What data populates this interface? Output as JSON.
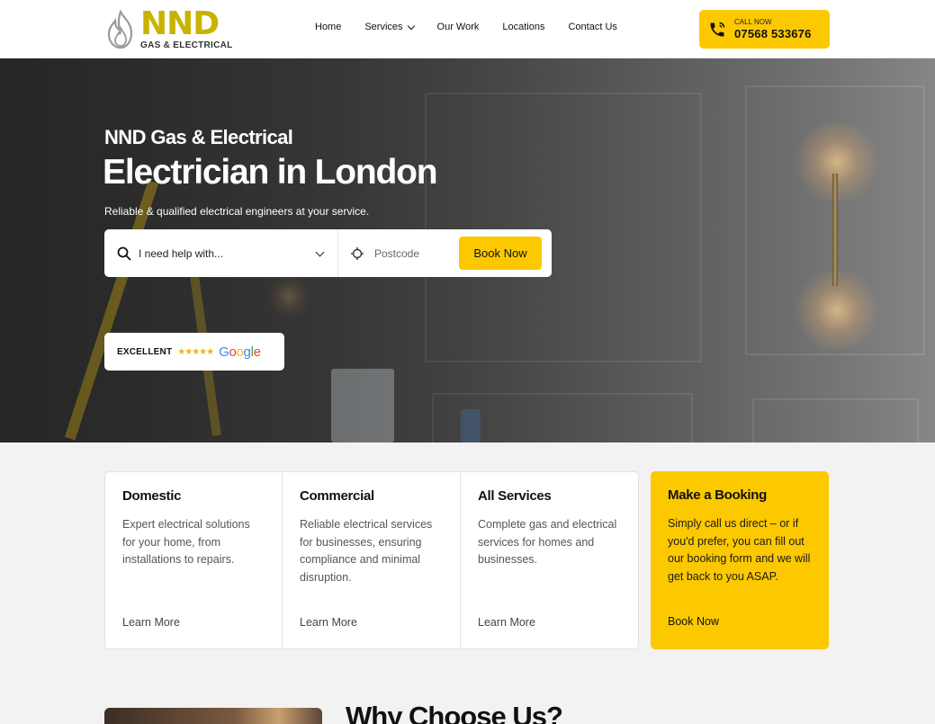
{
  "header": {
    "logo_main": "NND",
    "logo_sub": "GAS & ELECTRICAL",
    "nav": [
      {
        "label": "Home"
      },
      {
        "label": "Services"
      },
      {
        "label": "Our Work"
      },
      {
        "label": "Locations"
      },
      {
        "label": "Contact Us"
      }
    ],
    "call_label": "CALL NOW",
    "call_number": "07568 533676"
  },
  "hero": {
    "subtitle": "NND Gas & Electrical",
    "title": "Electrician in London",
    "tagline": "Reliable & qualified electrical engineers at your service.",
    "search": {
      "select_value": "I need help with...",
      "postcode_placeholder": "Postcode",
      "book_label": "Book Now"
    },
    "review": {
      "label": "EXCELLENT",
      "stars": "★★★★★",
      "rating": 5,
      "brand": "Google"
    }
  },
  "cards": [
    {
      "title": "Domestic",
      "text": "Expert electrical solutions for your home, from installations to repairs.",
      "link": "Learn More"
    },
    {
      "title": "Commercial",
      "text": "Reliable electrical services for businesses, ensuring compliance and minimal disruption.",
      "link": "Learn More"
    },
    {
      "title": "All Services",
      "text": "Complete gas and electrical services for homes and businesses.",
      "link": "Learn More"
    },
    {
      "title": "Make a Booking",
      "text": "Simply call us direct – or if you'd prefer, you can fill out our booking form and we will get back to you ASAP.",
      "link": "Book Now"
    }
  ],
  "why": {
    "title": "Why Choose Us?"
  },
  "colors": {
    "accent": "#fcc800",
    "logo": "#c7b300",
    "text": "#111111"
  },
  "icons": [
    "flame-icon",
    "chevron-down-icon",
    "phone-icon",
    "search-icon",
    "location-target-icon",
    "star-icon"
  ]
}
